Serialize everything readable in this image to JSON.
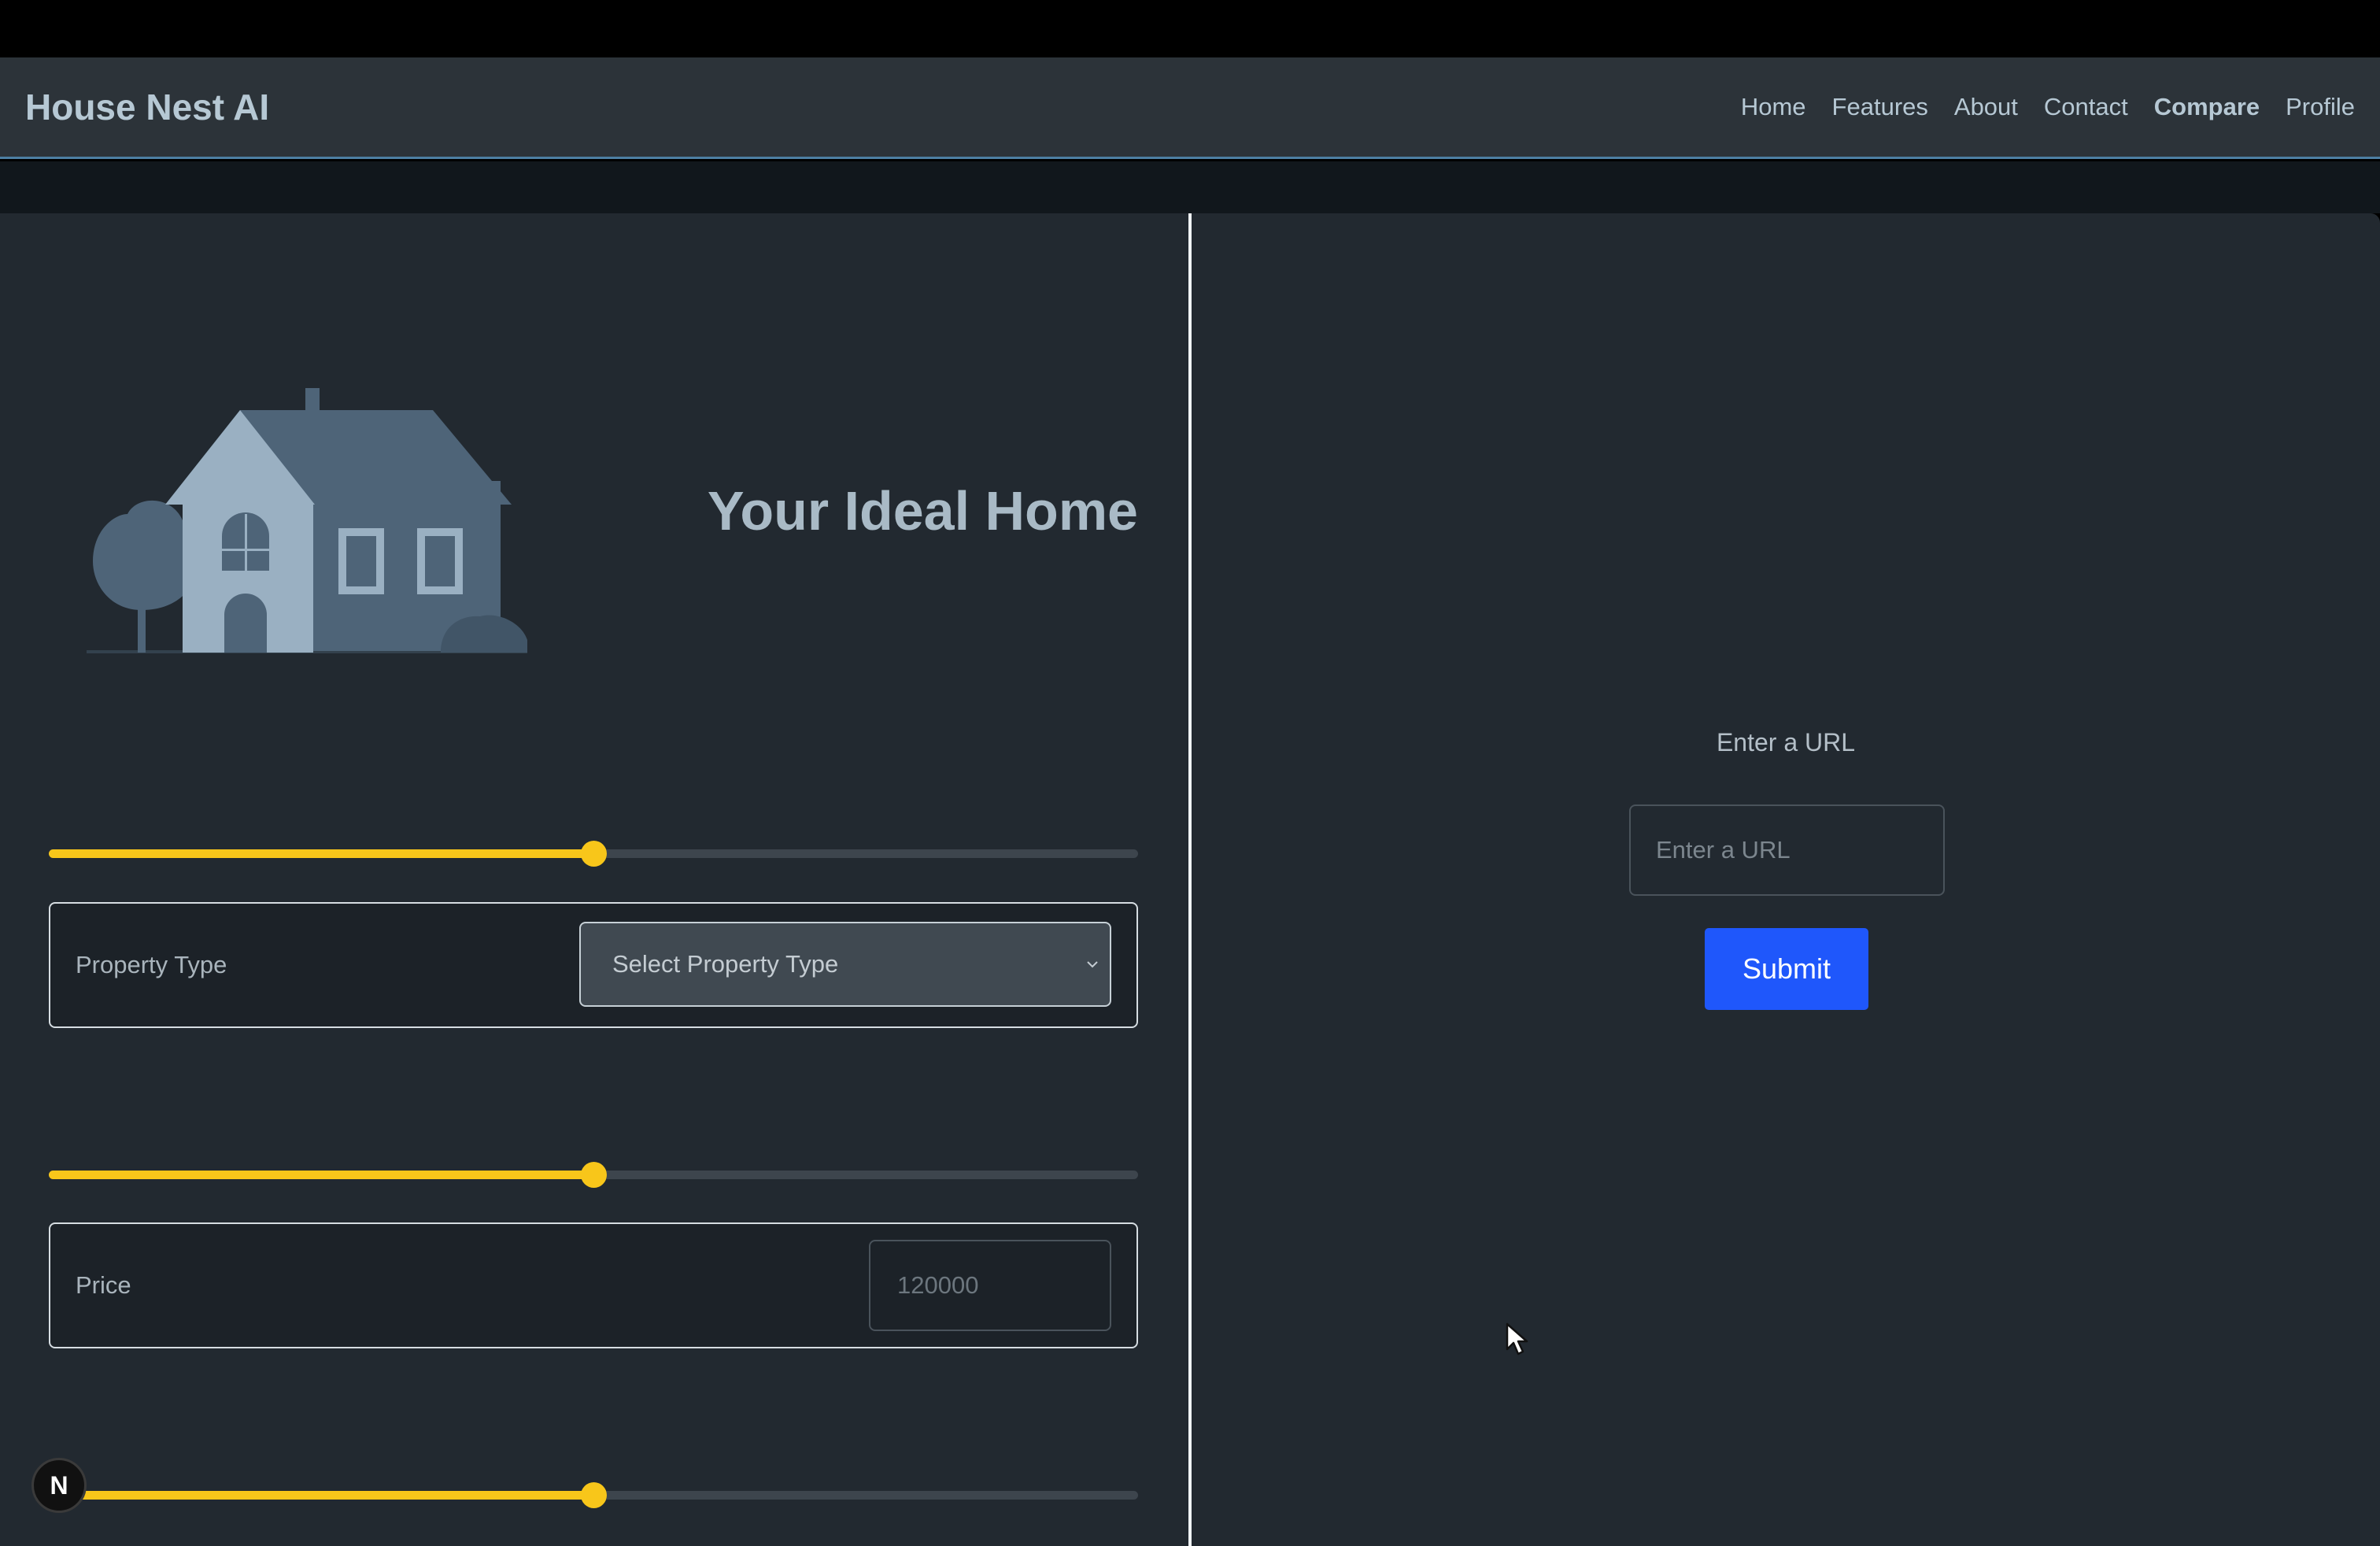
{
  "navbar": {
    "brand": "House Nest AI",
    "links": [
      {
        "label": "Home",
        "bold": false
      },
      {
        "label": "Features",
        "bold": false
      },
      {
        "label": "About",
        "bold": false
      },
      {
        "label": "Contact",
        "bold": false
      },
      {
        "label": "Compare",
        "bold": true
      },
      {
        "label": "Profile",
        "bold": false
      }
    ]
  },
  "left_panel": {
    "hero_title": "Your Ideal Home",
    "house_icon": "house-illustration-icon",
    "sliders": [
      {
        "name": "property-type-slider",
        "value_fraction": 0.5
      },
      {
        "name": "price-slider",
        "value_fraction": 0.5
      },
      {
        "name": "third-slider",
        "value_fraction": 0.5
      }
    ],
    "property_type": {
      "label": "Property Type",
      "selected": "Select Property Type"
    },
    "price": {
      "label": "Price",
      "placeholder": "120000"
    }
  },
  "right_panel": {
    "url_label": "Enter a URL",
    "url_placeholder": "Enter a URL",
    "submit_label": "Submit"
  },
  "dev_badge": {
    "letter": "N"
  },
  "colors": {
    "accent_yellow": "#f8c61a",
    "submit_blue": "#1f57fb",
    "panel_bg": "#222930",
    "navbar_bg": "#2c3339"
  }
}
